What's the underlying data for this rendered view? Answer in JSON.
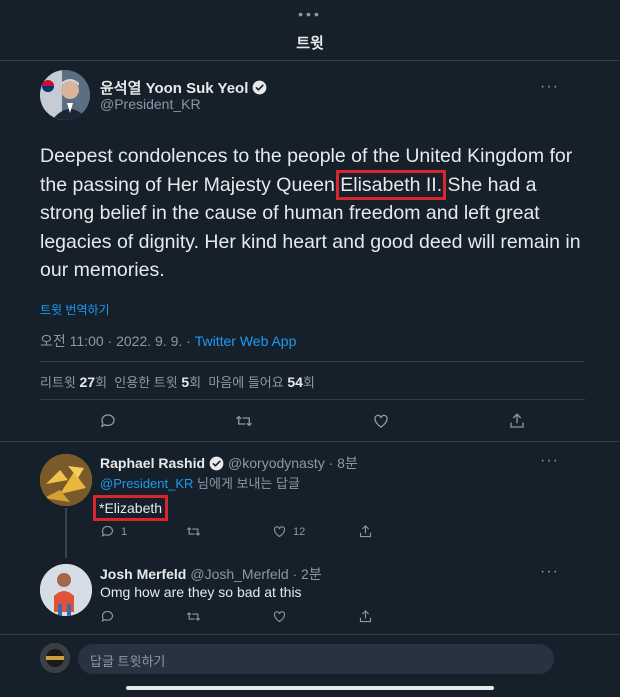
{
  "header": {
    "handle_dots": "•••",
    "title": "트윗"
  },
  "tweet": {
    "author_name": "윤석열 Yoon Suk Yeol",
    "author_handle": "@President_KR",
    "text_before": "Deepest condolences to the people of the United Kingdom for the passing of Her Majesty Queen ",
    "text_highlight": "Elisabeth II.",
    "text_after": " She had a strong belief in the cause of human freedom and left great legacies of dignity. Her kind heart and good deed will remain in our memories.",
    "translate_label": "트윗 번역하기",
    "timestamp": "오전 11:00 · 2022. 9. 9. · ",
    "source": "Twitter Web App",
    "stats": {
      "retweets_label": "리트윗",
      "retweets": "27",
      "retweets_unit": "회",
      "quotes_label": "인용한 트윗",
      "quotes": "5",
      "quotes_unit": "회",
      "likes_label": "마음에 들어요",
      "likes": "54",
      "likes_unit": "회"
    }
  },
  "replies": [
    {
      "name": "Raphael Rashid",
      "handle_time": "@koryodynasty · 8분",
      "reply_to_mention": "@President_KR",
      "reply_to_suffix": " 님에게 보내는 답글",
      "text": "*Elizabeth",
      "reply_count": "1",
      "like_count": "12"
    },
    {
      "name": "Josh Merfeld",
      "handle_time": "@Josh_Merfeld · 2분",
      "text": "Omg how are they so bad at this"
    }
  ],
  "composer": {
    "placeholder": "답글 트윗하기"
  },
  "colors": {
    "accent": "#1d9bf0",
    "highlight_box": "#d9262e",
    "background": "#15202b"
  }
}
